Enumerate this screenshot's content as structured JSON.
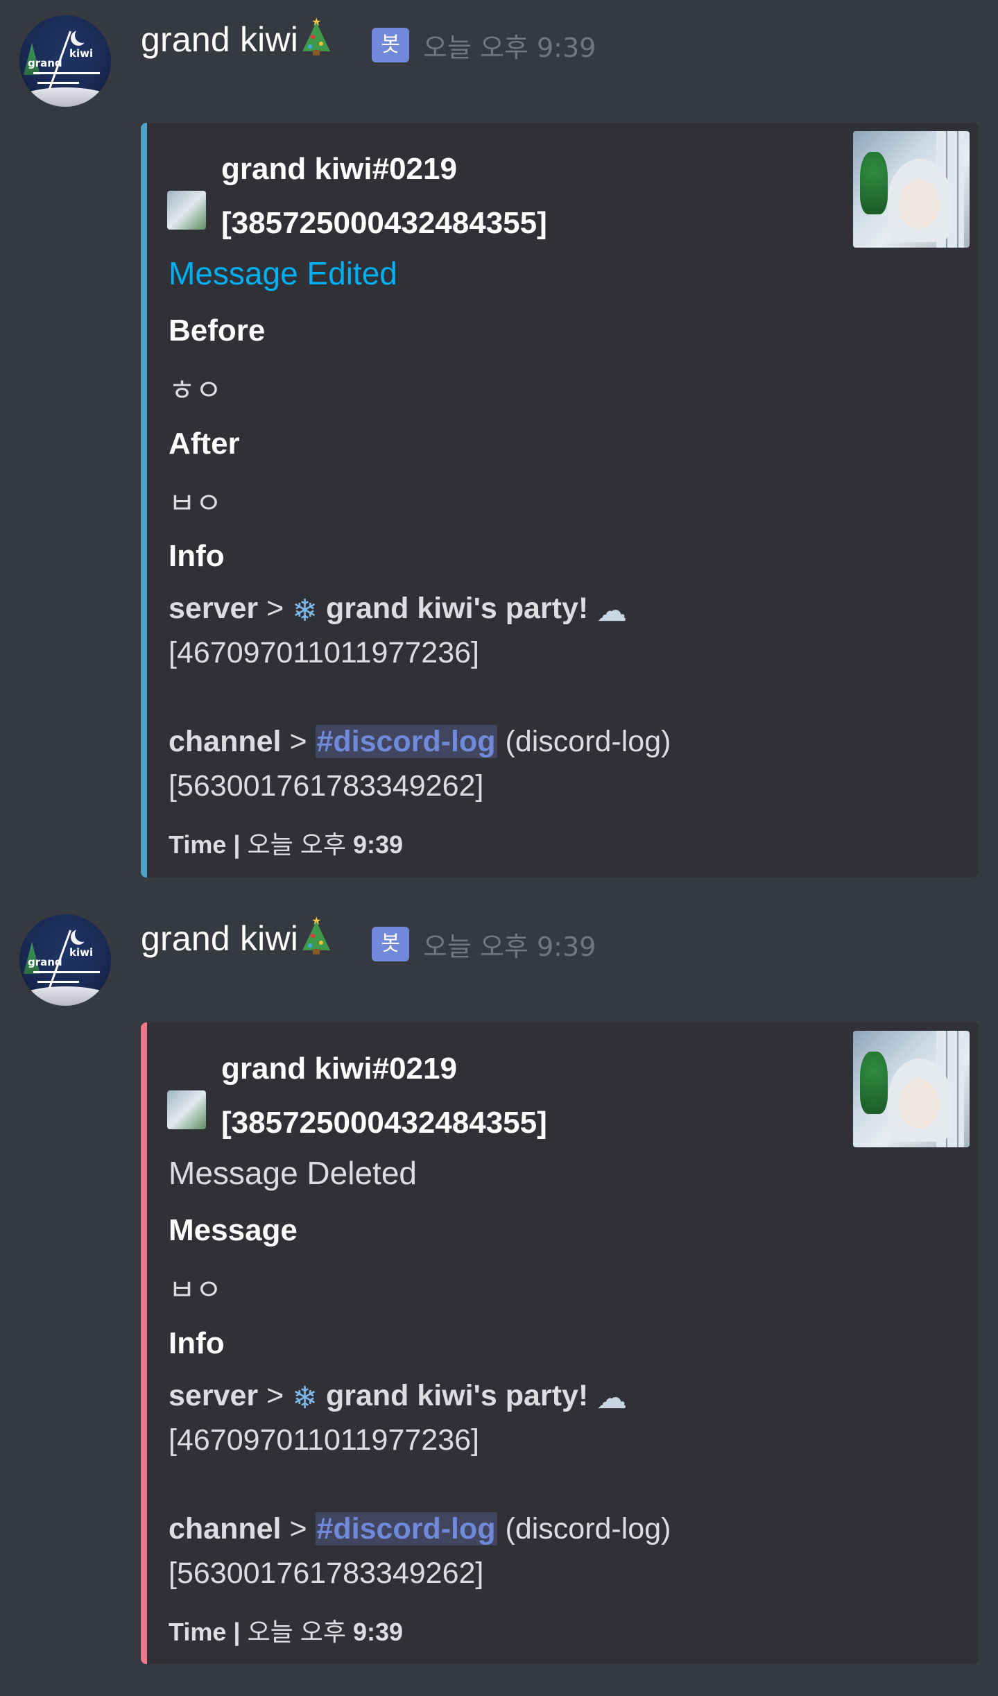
{
  "messages": [
    {
      "author": "grand kiwi",
      "bot_tag": "봇",
      "timestamp": "오늘 오후 9:39",
      "embed": {
        "color": "#4ca2c7",
        "author_name": "grand kiwi#0219",
        "author_id": "[385725000432484355]",
        "title": "Message Edited",
        "title_color": "#00b0f4",
        "fields": [
          {
            "name": "Before",
            "value": "ㅎㅇ"
          },
          {
            "name": "After",
            "value": "ㅂㅇ"
          }
        ],
        "info_label": "Info",
        "server_label": "server",
        "server_name": "grand kiwi's party!",
        "server_id": "[467097011011977236]",
        "channel_label": "channel",
        "channel_mention": "#discord-log",
        "channel_name": "(discord-log)",
        "channel_id": "[563001761783349262]",
        "time_label": "Time",
        "time_prefix": "오늘 오후",
        "time_value": "9:39"
      }
    },
    {
      "author": "grand kiwi",
      "bot_tag": "봇",
      "timestamp": "오늘 오후 9:39",
      "embed": {
        "color": "#f0768b",
        "author_name": "grand kiwi#0219",
        "author_id": "[385725000432484355]",
        "title": "Message Deleted",
        "title_color": "#dcddde",
        "fields": [
          {
            "name": "Message",
            "value": "ㅂㅇ"
          }
        ],
        "info_label": "Info",
        "server_label": "server",
        "server_name": "grand kiwi's party!",
        "server_id": "[467097011011977236]",
        "channel_label": "channel",
        "channel_mention": "#discord-log",
        "channel_name": "(discord-log)",
        "channel_id": "[563001761783349262]",
        "time_label": "Time",
        "time_prefix": "오늘 오후",
        "time_value": "9:39"
      }
    }
  ],
  "avatar_text": [
    "grand",
    "kiwi"
  ],
  "icons": {
    "tree": "christmas-tree-icon",
    "snowflake": "snowflake-icon",
    "snow_cloud": "snow-cloud-icon"
  }
}
